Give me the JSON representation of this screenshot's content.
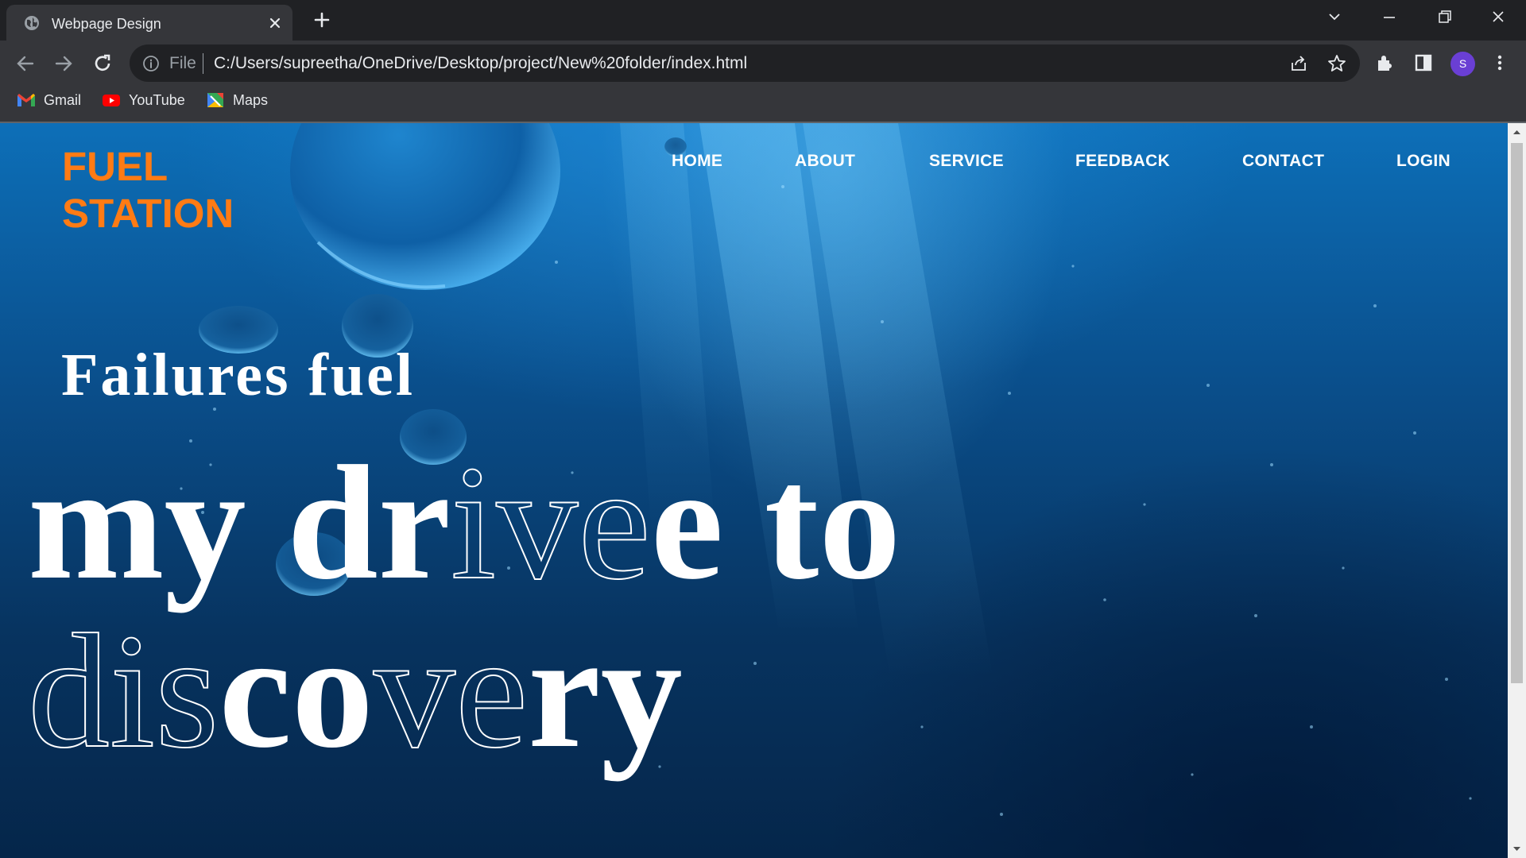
{
  "browser": {
    "tab_title": "Webpage Design",
    "omnibox": {
      "scheme_label": "File",
      "url": "C:/Users/supreetha/OneDrive/Desktop/project/New%20folder/index.html"
    },
    "profile_initial": "S",
    "bookmarks": [
      {
        "label": "Gmail",
        "icon": "gmail-icon"
      },
      {
        "label": "YouTube",
        "icon": "youtube-icon"
      },
      {
        "label": "Maps",
        "icon": "maps-icon"
      }
    ]
  },
  "page": {
    "logo": {
      "line1": "FUEL",
      "line2": "STATION"
    },
    "nav": [
      "HOME",
      "ABOUT",
      "SERVICE",
      "FEEDBACK",
      "CONTACT",
      "LOGIN"
    ],
    "hero": {
      "line1": "Failures fuel",
      "line2_solid_a": "my",
      "line2_outline_a": "",
      "line2_solid_b": "dr",
      "line2_outline_b": "ive",
      "line2_solid_c": "e to",
      "line3_outline_a": "dis",
      "line3_solid_b": "co",
      "line3_outline_c": "ve",
      "line3_solid_d": "ry"
    }
  },
  "colors": {
    "logo": "#ff7b14",
    "page_bg_top": "#0d6fb8",
    "page_bg_bottom": "#05264a",
    "chrome_dark": "#202124",
    "chrome_toolbar": "#35363a"
  }
}
